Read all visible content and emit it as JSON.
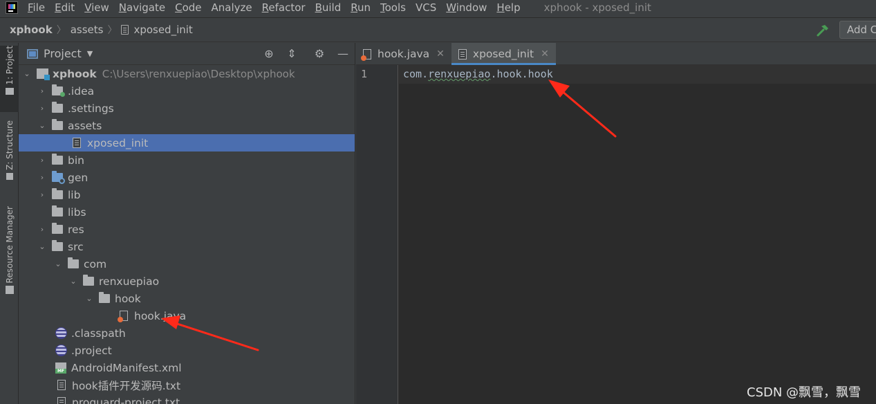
{
  "menubar": {
    "items": [
      {
        "first": "F",
        "rest": "ile"
      },
      {
        "first": "E",
        "rest": "dit"
      },
      {
        "first": "V",
        "rest": "iew"
      },
      {
        "first": "N",
        "rest": "avigate"
      },
      {
        "first": "C",
        "rest": "ode"
      },
      {
        "first": "",
        "rest": "Analyze"
      },
      {
        "first": "R",
        "rest": "efactor"
      },
      {
        "first": "B",
        "rest": "uild"
      },
      {
        "first": "R",
        "rest": "un"
      },
      {
        "first": "T",
        "rest": "ools"
      },
      {
        "first": "",
        "rest": "VCS"
      },
      {
        "first": "W",
        "rest": "indow"
      },
      {
        "first": "H",
        "rest": "elp"
      }
    ],
    "window_title": "xphook - xposed_init"
  },
  "navbar": {
    "crumbs": [
      "xphook",
      "assets",
      "xposed_init"
    ],
    "add_config_label": "Add C"
  },
  "stripe": {
    "project_label": "1: Project",
    "structure_label": "Z: Structure",
    "resource_label": "Resource Manager"
  },
  "project": {
    "title": "Project",
    "root_name": "xphook",
    "root_path": "C:\\Users\\renxuepiao\\Desktop\\xphook",
    "items": {
      "idea": ".idea",
      "settings": ".settings",
      "assets": "assets",
      "xposed_init": "xposed_init",
      "bin": "bin",
      "gen": "gen",
      "lib": "lib",
      "libs": "libs",
      "res": "res",
      "src": "src",
      "com": "com",
      "renxuepiao": "renxuepiao",
      "hook": "hook",
      "hook_java": "hook.java",
      "classpath": ".classpath",
      "dotproject": ".project",
      "manifest": "AndroidManifest.xml",
      "hook_txt": "hook插件开发源码.txt",
      "proguard": "proguard-project.txt"
    }
  },
  "editor": {
    "tabs": [
      {
        "label": "hook.java"
      },
      {
        "label": "xposed_init"
      }
    ],
    "line_number": "1",
    "code": {
      "part1": "com.",
      "part2": "renxuepiao",
      "part3": ".hook.hook"
    }
  },
  "watermark": "CSDN @飘雪，飘雪",
  "colors": {
    "selection": "#4b6eaf",
    "tab_active_underline": "#4a88c7",
    "arrow": "#ff2a1a"
  }
}
